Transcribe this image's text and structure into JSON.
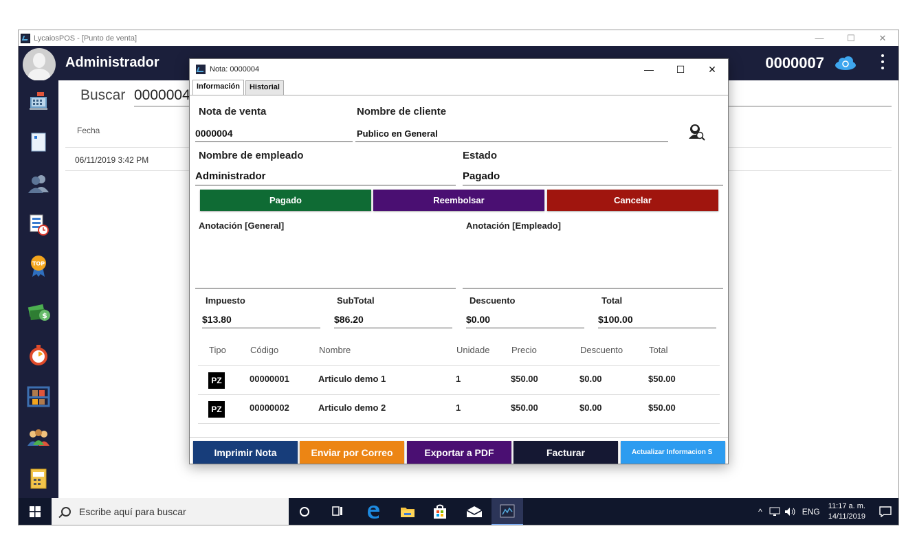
{
  "window": {
    "title": "LycaiosPOS - [Punto de venta]",
    "minimize": "—",
    "maximize": "☐",
    "close": "✕"
  },
  "header": {
    "user_name": "Administrador",
    "note_number": "0000007"
  },
  "sidebar": {
    "items": [
      "cart-register",
      "document",
      "customers",
      "reports-clock",
      "top-badge",
      "money",
      "timer",
      "warehouse",
      "employees",
      "calculator"
    ]
  },
  "background": {
    "search_label": "Buscar",
    "search_value": "0000004",
    "column_fecha": "Fecha",
    "row_date": "06/11/2019 3:42 PM"
  },
  "dialog": {
    "title": "Nota: 0000004",
    "tabs": [
      "Información",
      "Historial"
    ],
    "sale_note_label": "Nota de venta",
    "sale_note_value": "0000004",
    "client_label": "Nombre de cliente",
    "client_value": "Publico en General",
    "employee_label": "Nombre de empleado",
    "employee_value": "Administrador",
    "status_label": "Estado",
    "status_value": "Pagado",
    "buttons": {
      "paid": "Pagado",
      "refund": "Reembolsar",
      "cancel": "Cancelar"
    },
    "annotation_general_label": "Anotación [General]",
    "annotation_employee_label": "Anotación [Empleado]",
    "tax_label": "Impuesto",
    "tax_value": "$13.80",
    "subtotal_label": "SubTotal",
    "subtotal_value": "$86.20",
    "discount_label": "Descuento",
    "discount_value": "$0.00",
    "total_label": "Total",
    "total_value": "$100.00",
    "table": {
      "headers": [
        "Tipo",
        "Código",
        "Nombre",
        "Unidade",
        "Precio",
        "Descuento",
        "Total"
      ],
      "rows": [
        {
          "tipo": "PZ",
          "codigo": "00000001",
          "nombre": "Articulo demo 1",
          "unidad": "1",
          "precio": "$50.00",
          "descuento": "$0.00",
          "total": "$50.00"
        },
        {
          "tipo": "PZ",
          "codigo": "00000002",
          "nombre": "Articulo demo 2",
          "unidad": "1",
          "precio": "$50.00",
          "descuento": "$0.00",
          "total": "$50.00"
        }
      ]
    },
    "bottom_buttons": {
      "print": "Imprimir Nota",
      "email": "Enviar por Correo",
      "pdf": "Exportar a PDF",
      "invoice": "Facturar",
      "update": "Actualizar Informacion S"
    }
  },
  "taskbar": {
    "search_placeholder": "Escribe aquí para buscar",
    "language": "ENG",
    "time": "11:17 a. m.",
    "date": "14/11/2019"
  },
  "colors": {
    "app_dark": "#1b1f3b",
    "paid_green": "#0f6b34",
    "refund_purple": "#4a0f72",
    "cancel_red": "#a0150e",
    "print_blue": "#173d7a",
    "email_orange": "#ec8514",
    "pdf_purple": "#4a0f72",
    "invoice_dark": "#151833",
    "update_lightblue": "#2d9cf0"
  }
}
